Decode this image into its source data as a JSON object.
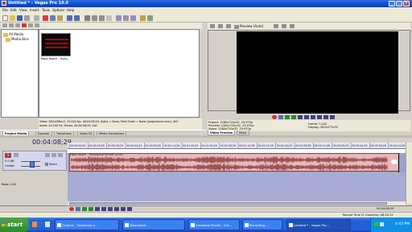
{
  "window": {
    "title": "Untitled * - Vegas Pro 10.0",
    "min": "_",
    "max": "□",
    "close": "×"
  },
  "menu": [
    "File",
    "Edit",
    "View",
    "Insert",
    "Tools",
    "Options",
    "Help"
  ],
  "explorer": {
    "tree": [
      "All Media",
      "Media Bins"
    ]
  },
  "media": {
    "clip_name": "Papa Roach - Holly...",
    "thumb_text": "Papa Roach",
    "info_line1": "Video: 384x288x12, 25.000 fps, 00:04:08;29, Alpha = None, Field Order = None (progressive scan), AVC",
    "info_line2": "Audio: 44,100 Hz, Stereo, 00:04:08;29, AAC"
  },
  "tabs_left": [
    "Project Media",
    "Explorer",
    "Transitions",
    "Video FX",
    "Media Generators"
  ],
  "preview": {
    "label": "Preview (Auto)",
    "project": "Project:",
    "project_val": "1280x720x32, 29.970p",
    "preview_lbl": "Preview:",
    "preview_val": "1280x720x32, 29.970p",
    "video_lbl": "Video:",
    "video_val": "1280x720x32, 29.970p",
    "frame_lbl": "Frame:",
    "frame_val": "7,442",
    "display_lbl": "Display:",
    "display_val": "492x277x32"
  },
  "tabs_right": [
    "Video Preview",
    "Mixer"
  ],
  "timeline": {
    "timecode": "00:04:08;29",
    "ruler": [
      "00:00:00;00",
      "00:00:15;00",
      "00:00:29;29",
      "00:00:44;29",
      "00:00:59;28",
      "00:01:14;28",
      "00:01:29;29",
      "00:01:44;29",
      "00:01:59;28",
      "00:02:14;28",
      "00:02:29;29",
      "00:02:44;29",
      "00:02:59;28",
      "00:03:14;28",
      "00:03:29;29",
      "00:03:44;29",
      "00:03:59;28",
      "00:04:14;28"
    ],
    "track_num": "1",
    "track_vol": "0.0 dB",
    "track_pan": "Center",
    "touch": "Touch",
    "clip_label": "Papa Roach - Hollywood Whore Lyrics"
  },
  "bottom": {
    "rate": "Rate: 0.00",
    "end_time": "00:04:08;29"
  },
  "status": {
    "record_time": "Record Time (2 channels): 08:50:15"
  },
  "taskbar": {
    "start": "start",
    "clock": "4:43 PM",
    "items": [
      "Untitled * - Vegas Pro...",
      "Recording...",
      "Camtasia Studio - Unt...",
      "Downloads",
      "Graphic - Download a..."
    ]
  },
  "colors": {
    "accent": "#0a4bd1",
    "clip": "#e8b8b8",
    "waveform": "#8a3a3a",
    "track_bg": "#9aa0c8"
  }
}
